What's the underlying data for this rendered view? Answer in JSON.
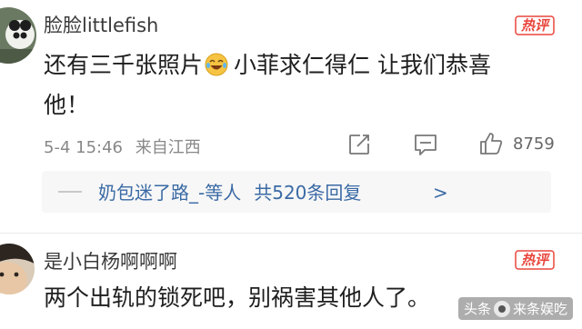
{
  "comments": [
    {
      "username": "脸脸littlefish",
      "hot_badge": "热评",
      "text_line1_a": "还有三千张照片",
      "emoji": "laughing-tears-emoji",
      "text_line1_b": "小菲求仁得仁  让我们恭喜",
      "text_line2": "他！",
      "date_time": "5-4 15:46",
      "location": "来自江西",
      "like_count": "8759",
      "replies": {
        "users": "奶包迷了路_-等人",
        "count_text": "共520条回复",
        "chevron": ">"
      }
    },
    {
      "username": "是小白杨啊啊啊",
      "hot_badge": "热评",
      "text": "两个出轨的锁死吧，别祸害其他人了。"
    }
  ],
  "watermark": {
    "prefix": "头条",
    "name": "来条娱吃"
  },
  "icons": {
    "repost": "repost-icon",
    "comment": "comment-icon",
    "like": "thumbs-up-icon"
  },
  "colors": {
    "hot_badge": "#e8463c",
    "link_blue": "#3a6aa5"
  }
}
